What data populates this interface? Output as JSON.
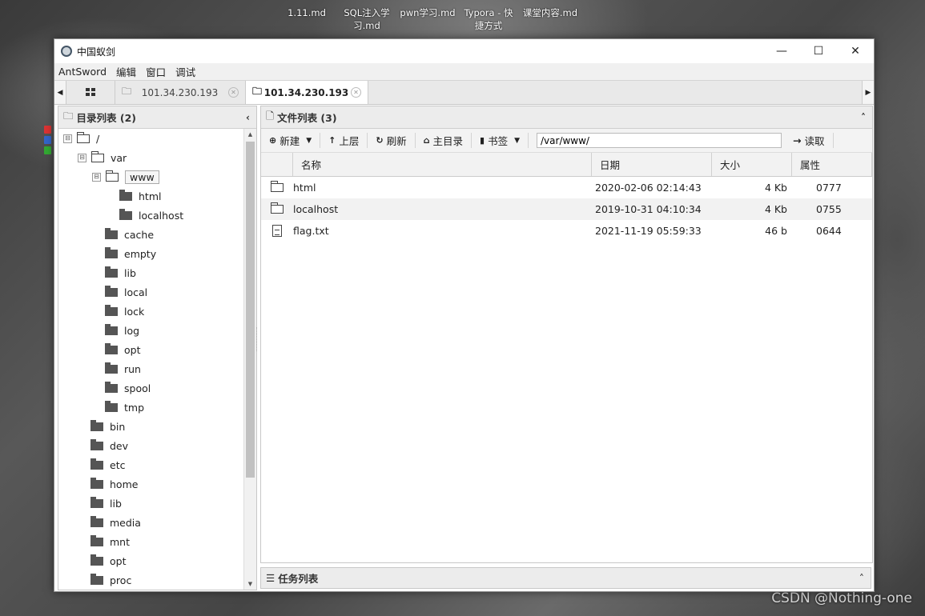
{
  "desktop": {
    "icons": [
      "1.11.md",
      "SQL注入学习.md",
      "pwn学习.md",
      "Typora - 快捷方式",
      "课堂内容.md"
    ],
    "watermark": "CSDN @Nothing-one"
  },
  "window": {
    "title": "中国蚁剑",
    "controls": {
      "minimize": "—",
      "maximize": "☐",
      "close": "✕"
    }
  },
  "menu": [
    "AntSword",
    "编辑",
    "窗口",
    "调试"
  ],
  "tabs": [
    {
      "label": "101.34.230.193",
      "active": false
    },
    {
      "label": "101.34.230.193",
      "active": true
    }
  ],
  "dir_panel": {
    "title": "目录列表 (2)",
    "collapse": "‹",
    "tree": [
      {
        "label": "/",
        "level": 0,
        "open": true,
        "toggle": "⊟"
      },
      {
        "label": "var",
        "level": 1,
        "open": true,
        "toggle": "⊟"
      },
      {
        "label": "www",
        "level": 2,
        "open": true,
        "toggle": "⊟",
        "selected": true
      },
      {
        "label": "html",
        "level": 3
      },
      {
        "label": "localhost",
        "level": 3
      },
      {
        "label": "cache",
        "level": 2
      },
      {
        "label": "empty",
        "level": 2
      },
      {
        "label": "lib",
        "level": 2
      },
      {
        "label": "local",
        "level": 2
      },
      {
        "label": "lock",
        "level": 2
      },
      {
        "label": "log",
        "level": 2
      },
      {
        "label": "opt",
        "level": 2
      },
      {
        "label": "run",
        "level": 2
      },
      {
        "label": "spool",
        "level": 2
      },
      {
        "label": "tmp",
        "level": 2
      },
      {
        "label": "bin",
        "level": 1
      },
      {
        "label": "dev",
        "level": 1
      },
      {
        "label": "etc",
        "level": 1
      },
      {
        "label": "home",
        "level": 1
      },
      {
        "label": "lib",
        "level": 1
      },
      {
        "label": "media",
        "level": 1
      },
      {
        "label": "mnt",
        "level": 1
      },
      {
        "label": "opt",
        "level": 1
      },
      {
        "label": "proc",
        "level": 1
      }
    ]
  },
  "file_panel": {
    "title": "文件列表 (3)",
    "collapse": "˄",
    "toolbar": {
      "new": "新建",
      "up": "上层",
      "refresh": "刷新",
      "home": "主目录",
      "bookmark": "书签",
      "path": "/var/www/",
      "read": "读取"
    },
    "columns": [
      "名称",
      "日期",
      "大小",
      "属性"
    ],
    "files": [
      {
        "type": "folder",
        "name": "html",
        "date": "2020-02-06 02:14:43",
        "size": "4 Kb",
        "attr": "0777"
      },
      {
        "type": "folder",
        "name": "localhost",
        "date": "2019-10-31 04:10:34",
        "size": "4 Kb",
        "attr": "0755"
      },
      {
        "type": "file",
        "name": "flag.txt",
        "date": "2021-11-19 05:59:33",
        "size": "46 b",
        "attr": "0644"
      }
    ]
  },
  "task_panel": {
    "title": "任务列表",
    "collapse": "˄"
  }
}
